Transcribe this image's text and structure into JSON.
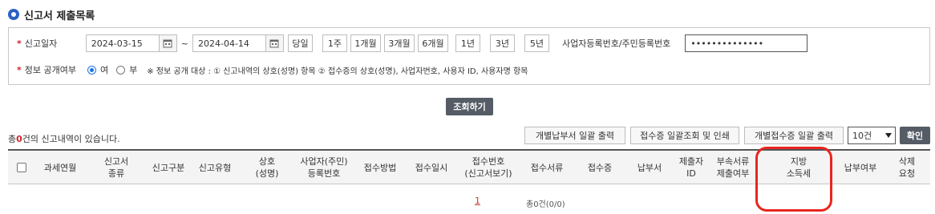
{
  "page": {
    "title": "신고서 제출목록"
  },
  "search": {
    "date_label": "신고일자",
    "start_date": "2024-03-15",
    "end_date": "2024-04-14",
    "tilde": "~",
    "periods": [
      "당일",
      "1주",
      "1개월",
      "3개월",
      "6개월",
      "1년",
      "3년",
      "5년"
    ],
    "bizno_label": "사업자등록번호/주민등록번호",
    "bizno_value": "••••••••••••••",
    "disclosure_label": "정보 공개여부",
    "yes_label": "여",
    "no_label": "부",
    "disclosure_note": "※ 정보 공개 대상 : ① 신고내역의 상호(성명) 항목 ② 접수증의 상호(성명), 사업자번호, 사용자 ID, 사용자명 항목",
    "search_button": "조회하기"
  },
  "results": {
    "count_prefix": "총",
    "count_value": "0",
    "count_suffix": "건의 신고내역이 있습니다.",
    "btn_payment_print": "개별납부서 일괄 출력",
    "btn_receipt_print": "접수증 일괄조회 및 인쇄",
    "btn_individual_receipt": "개별접수증 일괄 출력",
    "page_size": "10건",
    "confirm": "확인"
  },
  "table": {
    "headers": [
      "과세연월",
      "신고서\n종류",
      "신고구분",
      "신고유형",
      "상호\n(성명)",
      "사업자(주민)\n등록번호",
      "접수방법",
      "접수일시",
      "접수번호\n(신고서보기)",
      "접수서류",
      "접수증",
      "납부서",
      "제출자\nID",
      "부속서류\n제출여부",
      "지방\n소득세",
      "납부여부",
      "삭제\n요청"
    ]
  },
  "pagination": {
    "current": "1",
    "total_text": "총0건(0/0)"
  },
  "colors": {
    "accent": "#2a61c4",
    "required": "#d3212d",
    "highlight": "#e8261f",
    "dark_button": "#555c66"
  }
}
